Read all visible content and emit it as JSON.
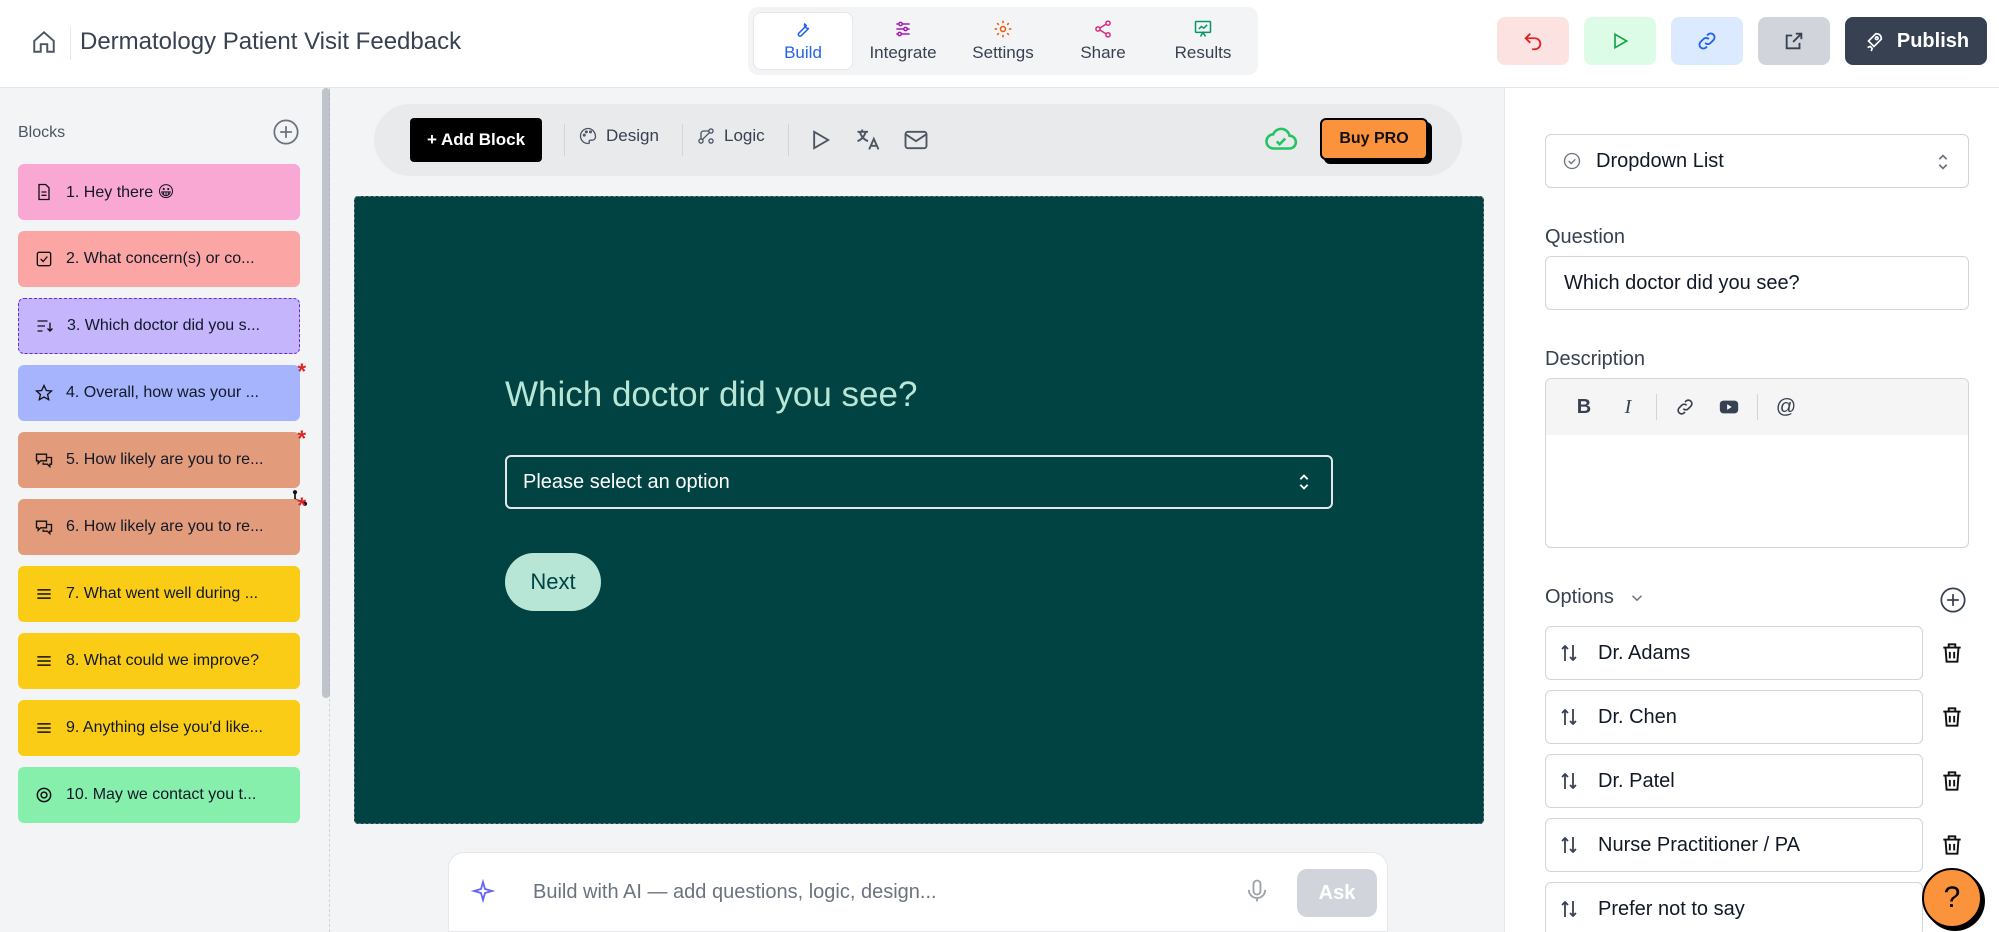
{
  "header": {
    "title": "Dermatology Patient Visit Feedback",
    "tabs": [
      {
        "label": "Build"
      },
      {
        "label": "Integrate"
      },
      {
        "label": "Settings"
      },
      {
        "label": "Share"
      },
      {
        "label": "Results"
      }
    ],
    "publish_label": "Publish"
  },
  "sidebar": {
    "label": "Blocks",
    "blocks": [
      {
        "label": "1. Hey there 😀"
      },
      {
        "label": "2. What concern(s) or co..."
      },
      {
        "label": "3. Which doctor did you s..."
      },
      {
        "label": "4. Overall, how was your ..."
      },
      {
        "label": "5. How likely are you to re..."
      },
      {
        "label": "6. How likely are you to re..."
      },
      {
        "label": "7. What went well during ..."
      },
      {
        "label": "8. What could we improve?"
      },
      {
        "label": "9. Anything else you'd like..."
      },
      {
        "label": "10. May we contact you t..."
      }
    ],
    "required_mark": "*"
  },
  "toolbar": {
    "add_block": "+ Add Block",
    "design": "Design",
    "logic": "Logic",
    "buy_pro": "Buy PRO"
  },
  "canvas": {
    "question": "Which doctor did you see?",
    "select_placeholder": "Please select an option",
    "next_label": "Next"
  },
  "ai": {
    "placeholder": "Build with AI — add questions, logic, design...",
    "ask_label": "Ask"
  },
  "panel": {
    "type": "Dropdown List",
    "question_label": "Question",
    "question_value": "Which doctor did you see?",
    "description_label": "Description",
    "options_label": "Options",
    "options": [
      {
        "label": "Dr. Adams"
      },
      {
        "label": "Dr. Chen"
      },
      {
        "label": "Dr. Patel"
      },
      {
        "label": "Nurse Practitioner / PA"
      },
      {
        "label": "Prefer not to say"
      }
    ]
  },
  "help_label": "?",
  "colors": {
    "canvas_bg": "#014342",
    "accent_text": "#b8e6d6",
    "buy_pro": "#fb923c",
    "active_tab": "#2563eb"
  }
}
